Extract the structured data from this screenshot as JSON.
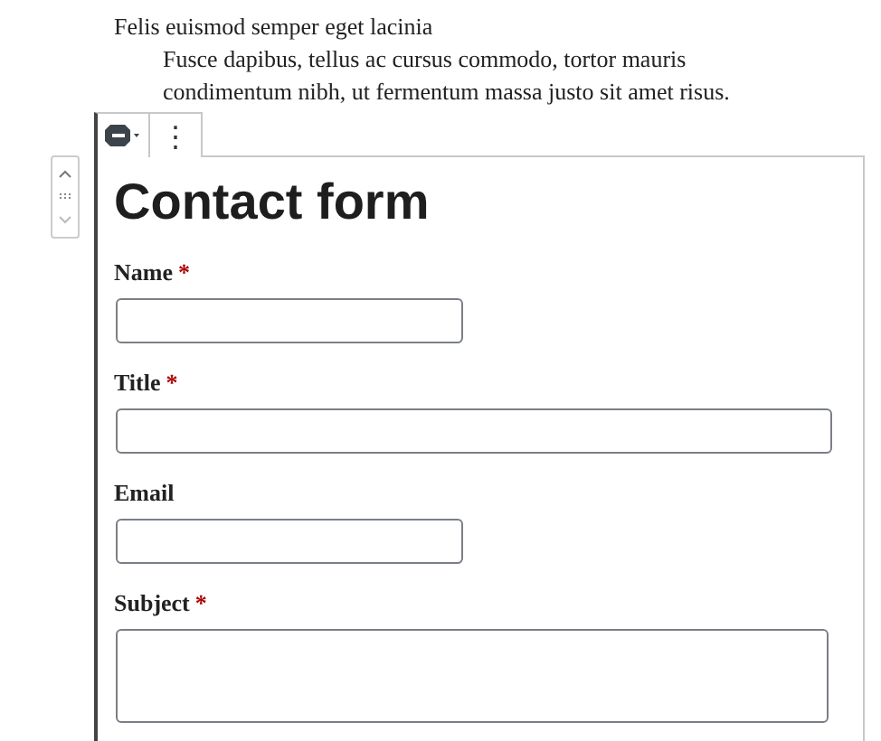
{
  "list": {
    "item": "Felis euismod semper eget lacinia",
    "subitem_lines": [
      "Fusce dapibus, tellus ac cursus commodo, tortor mauris",
      "condimentum nibh, ut fermentum massa justo sit amet risus."
    ]
  },
  "block_toolbar": {
    "options": "⋮"
  },
  "form": {
    "title": "Contact form",
    "fields": [
      {
        "label": "Name",
        "required_mark": "*",
        "kind": "short"
      },
      {
        "label": "Title",
        "required_mark": "*",
        "kind": "wide"
      },
      {
        "label": "Email",
        "kind": "short"
      },
      {
        "label": "Subject",
        "required_mark": "*",
        "kind": "textarea"
      }
    ]
  }
}
